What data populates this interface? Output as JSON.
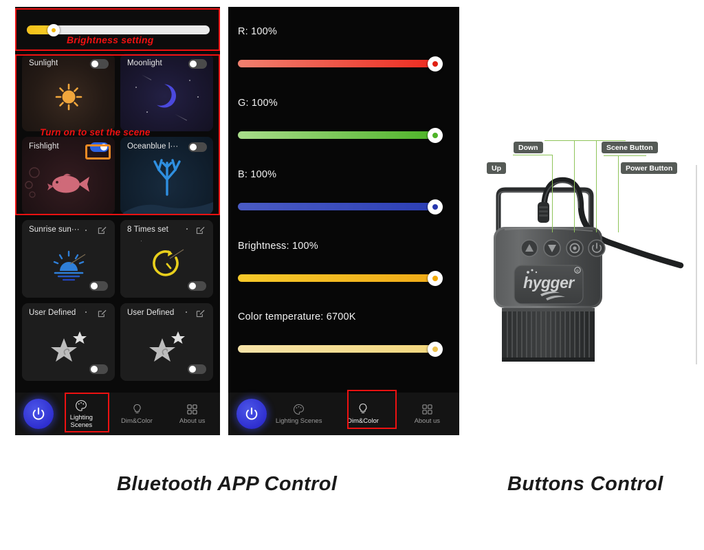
{
  "captions": {
    "left": "Bluetooth APP Control",
    "right": "Buttons Control"
  },
  "annotations": {
    "brightness_setting": "Brightness setting",
    "turn_on_scene": "Turn on to set the scene",
    "highlight_color": "#ee1111",
    "toggle_highlight_color": "#f08a24"
  },
  "lighting_scenes_screen": {
    "brightness_slider": {
      "name": "brightness",
      "value_percent": 13,
      "fill_color": "#f4c017",
      "track_color": "#e9e9e9"
    },
    "cards": [
      {
        "title": "Sunlight",
        "icon": "sun-icon",
        "toggle_on": false,
        "toggle_position": "top-right",
        "editable": false
      },
      {
        "title": "Moonlight",
        "icon": "moon-icon",
        "toggle_on": false,
        "toggle_position": "top-right",
        "editable": false
      },
      {
        "title": "Fishlight",
        "icon": "fish-icon",
        "toggle_on": true,
        "toggle_position": "top-right",
        "editable": false
      },
      {
        "title": "Oceanblue l···",
        "icon": "coral-icon",
        "toggle_on": false,
        "toggle_position": "top-right",
        "editable": false
      },
      {
        "title": "Sunrise sun···",
        "icon": "sunrise-icon",
        "toggle_on": false,
        "toggle_position": "bottom-right",
        "editable": true
      },
      {
        "title": "8 Times set",
        "icon": "timer-icon",
        "toggle_on": false,
        "toggle_position": "bottom-right",
        "editable": true
      },
      {
        "title": "User Defined",
        "icon": "star-icon",
        "toggle_on": false,
        "toggle_position": "bottom-right",
        "editable": true
      },
      {
        "title": "User Defined",
        "icon": "star-icon",
        "toggle_on": false,
        "toggle_position": "bottom-right",
        "editable": true
      }
    ],
    "nav": {
      "power_icon": "power-icon",
      "items": [
        {
          "label": "Lighting\nScenes",
          "icon": "palette-icon",
          "active": true,
          "highlighted": true
        },
        {
          "label": "Dim&Color",
          "icon": "bulb-icon",
          "active": false,
          "highlighted": false
        },
        {
          "label": "About us",
          "icon": "grid-icon",
          "active": false,
          "highlighted": false
        }
      ]
    }
  },
  "dim_color_screen": {
    "sliders": [
      {
        "label": "R: 100%",
        "key": "red",
        "value_percent": 100,
        "gradient_from": "#f0806f",
        "gradient_to": "#ee2b20",
        "thumb_dot": "#e01f12"
      },
      {
        "label": "G: 100%",
        "key": "green",
        "value_percent": 100,
        "gradient_from": "#a8dc8a",
        "gradient_to": "#4eb328",
        "thumb_dot": "#4eb328"
      },
      {
        "label": "B: 100%",
        "key": "blue",
        "value_percent": 100,
        "gradient_from": "#4a5bc4",
        "gradient_to": "#2c3fb5",
        "thumb_dot": "#2536ad"
      },
      {
        "label": "Brightness: 100%",
        "key": "brightness",
        "value_percent": 100,
        "gradient_from": "#f6c92a",
        "gradient_to": "#f0ab18",
        "thumb_dot": "#f2a800"
      },
      {
        "label": "Color temperature: 6700K",
        "key": "color_temp",
        "value_percent": 100,
        "gradient_from": "#f7e3a8",
        "gradient_to": "#f3d77e",
        "thumb_dot": "#edc24e"
      }
    ],
    "nav": {
      "power_icon": "power-icon",
      "items": [
        {
          "label": "Lighting Scenes",
          "icon": "palette-icon",
          "active": false,
          "highlighted": false
        },
        {
          "label": "Dim&Color",
          "icon": "bulb-icon",
          "active": true,
          "highlighted": true
        },
        {
          "label": "About us",
          "icon": "grid-icon",
          "active": false,
          "highlighted": false
        }
      ]
    }
  },
  "product": {
    "brand": "hygger",
    "trademark": "®",
    "callouts": [
      {
        "label": "Up",
        "name": "up-button"
      },
      {
        "label": "Down",
        "name": "down-button"
      },
      {
        "label": "Scene Button",
        "name": "scene-button"
      },
      {
        "label": "Power Button",
        "name": "power-button"
      }
    ],
    "leader_color": "#8fc45a",
    "callout_bg": "#555a56"
  }
}
